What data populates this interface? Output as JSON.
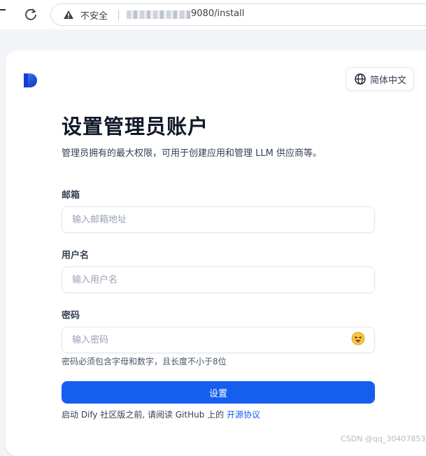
{
  "browser": {
    "security_label": "不安全",
    "url_suffix": "9080/install"
  },
  "header": {
    "language_label": "简体中文"
  },
  "form": {
    "title": "设置管理员账户",
    "subtitle": "管理员拥有的最大权限，可用于创建应用和管理 LLM 供应商等。",
    "email": {
      "label": "邮箱",
      "placeholder": "输入邮箱地址",
      "value": ""
    },
    "username": {
      "label": "用户名",
      "placeholder": "输入用户名",
      "value": ""
    },
    "password": {
      "label": "密码",
      "placeholder": "输入密码",
      "value": ""
    },
    "password_hint": "密码必须包含字母和数字，且长度不小于8位",
    "submit_label": "设置",
    "footer_text": "启动 Dify 社区版之前, 请阅读 GitHub 上的 ",
    "footer_link": "开源协议"
  },
  "watermark": "CSDN @qq_30407853",
  "colors": {
    "primary": "#155eef",
    "page_background": "#f2f4f7",
    "card_background": "#ffffff",
    "border": "#e4e7ec"
  },
  "icons": [
    "back-icon",
    "reload-icon",
    "warning-icon",
    "logo-icon",
    "globe-icon",
    "eye-emoji-icon"
  ]
}
